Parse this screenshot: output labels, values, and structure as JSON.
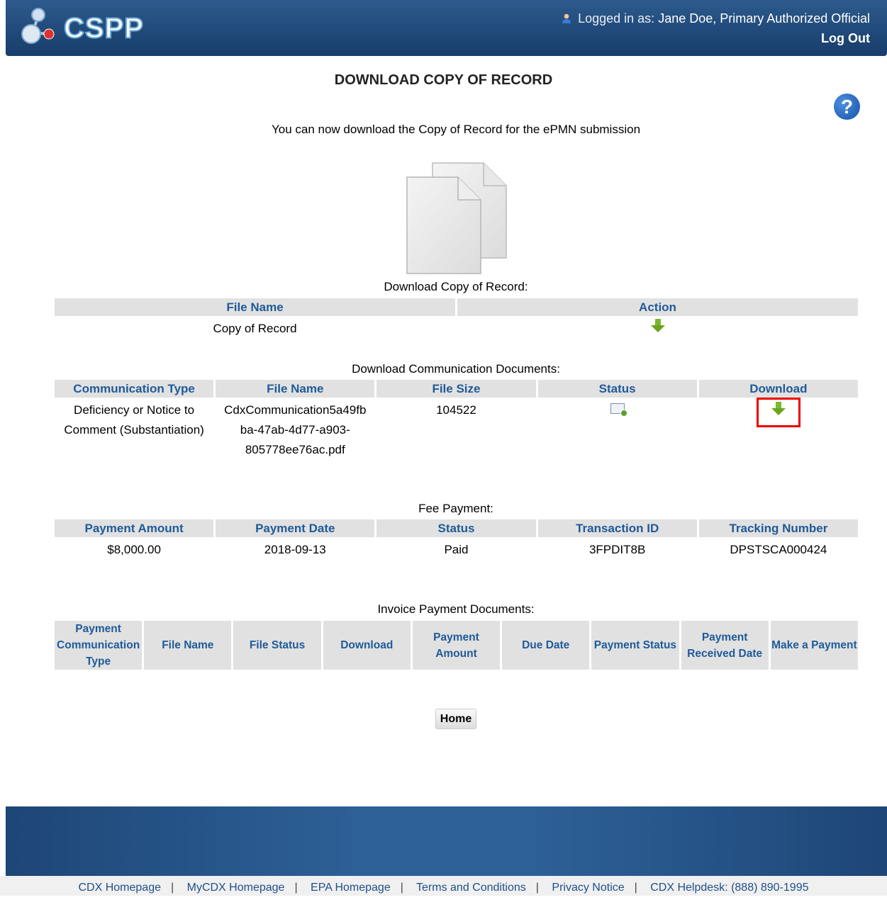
{
  "header": {
    "logo_text": "CSPP",
    "logged_in_label": "Logged in as:",
    "user_name": "Jane Doe, Primary Authorized Official",
    "logout_label": "Log Out"
  },
  "page": {
    "title": "DOWNLOAD COPY OF RECORD",
    "help_glyph": "?",
    "intro": "You can now download the Copy of Record for the ePMN submission"
  },
  "copy_of_record": {
    "label": "Download Copy of Record:",
    "headers": [
      "File Name",
      "Action"
    ],
    "row": {
      "file_name": "Copy of Record"
    }
  },
  "communications": {
    "label": "Download Communication Documents:",
    "headers": [
      "Communication Type",
      "File Name",
      "File Size",
      "Status",
      "Download"
    ],
    "row": {
      "type_line1": "Deficiency or Notice to",
      "type_line2": "Comment (Substantiation)",
      "file_line1": "CdxCommunication5a49fb",
      "file_line2": "ba-47ab-4d77-a903-",
      "file_line3": "805778ee76ac.pdf",
      "file_size": "104522"
    }
  },
  "fee_payment": {
    "label": "Fee Payment:",
    "headers": [
      "Payment Amount",
      "Payment Date",
      "Status",
      "Transaction ID",
      "Tracking Number"
    ],
    "row": {
      "amount": "$8,000.00",
      "date": "2018-09-13",
      "status": "Paid",
      "transaction_id": "3FPDIT8B",
      "tracking_number": "DPSTSCA000424"
    }
  },
  "invoice": {
    "label": "Invoice Payment Documents:",
    "headers": [
      "Payment Communication Type",
      "File Name",
      "File Status",
      "Download",
      "Payment Amount",
      "Due Date",
      "Payment Status",
      "Payment Received Date",
      "Make a Payment"
    ]
  },
  "home_label": "Home",
  "footer": {
    "links": [
      "CDX Homepage",
      "MyCDX Homepage",
      "EPA Homepage",
      "Terms and Conditions",
      "Privacy Notice",
      "CDX Helpdesk: (888) 890-1995"
    ]
  },
  "colors": {
    "header_bg": "#1f4a7d",
    "header_text": "#1f5a99",
    "highlight": "#e00000",
    "download_arrow": "#7cb82e"
  },
  "icons": [
    "user-icon",
    "help-icon",
    "documents-icon",
    "download-arrow-icon",
    "mail-status-icon"
  ]
}
